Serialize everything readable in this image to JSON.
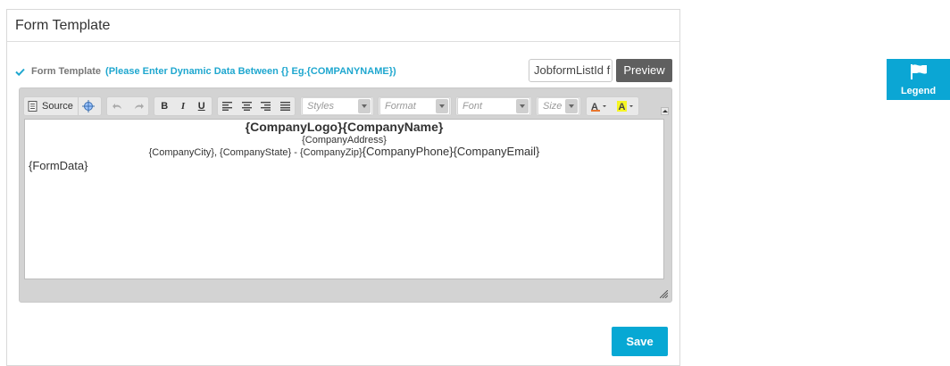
{
  "panel": {
    "title": "Form Template"
  },
  "form_template": {
    "checked": true,
    "label": "Form Template",
    "hint": "(Please Enter Dynamic Data Between {} Eg.{COMPANYNAME})"
  },
  "listid_input": {
    "value": "JobformListId f"
  },
  "preview_button": {
    "label": "Preview"
  },
  "toolbar": {
    "source_label": "Source",
    "styles_placeholder": "Styles",
    "format_placeholder": "Format",
    "font_placeholder": "Font",
    "size_placeholder": "Size"
  },
  "editor_content": {
    "line1": "{CompanyLogo}{CompanyName}",
    "line2": "{CompanyAddress}",
    "line3_small": "{CompanyCity}, {CompanyState} - {CompanyZip}",
    "line3_big": "{CompanyPhone}{CompanyEmail}",
    "line4": "{FormData}"
  },
  "save_button": {
    "label": "Save"
  },
  "legend": {
    "label": "Legend"
  },
  "colors": {
    "accent": "#07a8d4",
    "preview_bg": "#5f5f5f",
    "hint": "#1fa7cf"
  }
}
